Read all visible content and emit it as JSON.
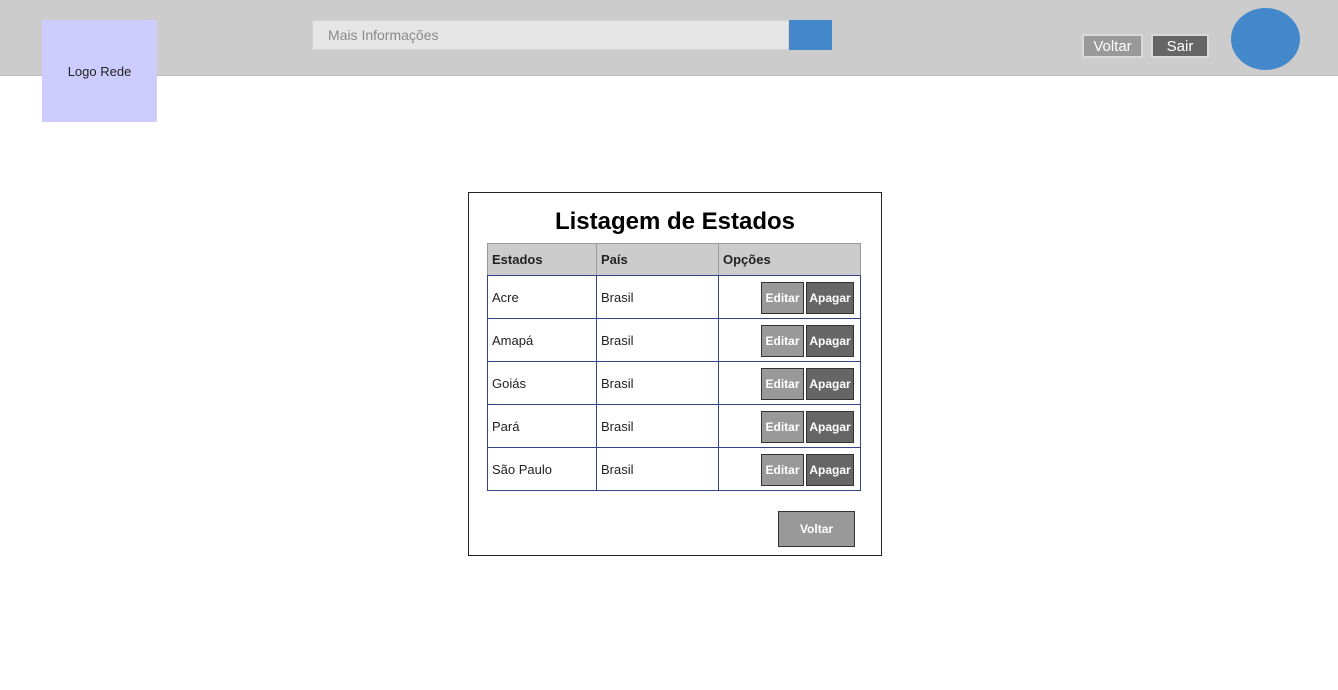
{
  "header": {
    "logo_text": "Logo Rede",
    "search": {
      "placeholder": "Mais Informações"
    },
    "voltar_label": "Voltar",
    "sair_label": "Sair"
  },
  "panel": {
    "title": "Listagem de Estados",
    "columns": [
      "Estados",
      "País",
      "Opções"
    ],
    "rows": [
      {
        "estado": "Acre",
        "pais": "Brasil"
      },
      {
        "estado": "Amapá",
        "pais": "Brasil"
      },
      {
        "estado": "Goiás",
        "pais": "Brasil"
      },
      {
        "estado": "Pará",
        "pais": "Brasil"
      },
      {
        "estado": "São Paulo",
        "pais": "Brasil"
      }
    ],
    "edit_label": "Editar",
    "delete_label": "Apagar",
    "back_label": "Voltar"
  },
  "colors": {
    "topbar": "#cccccc",
    "logo_bg": "#ccccff",
    "accent_blue": "#4488cc",
    "button_light": "#999999",
    "button_dark": "#666666"
  },
  "icons": {
    "avatar": "user-avatar-circle",
    "search_button": "search-icon"
  }
}
